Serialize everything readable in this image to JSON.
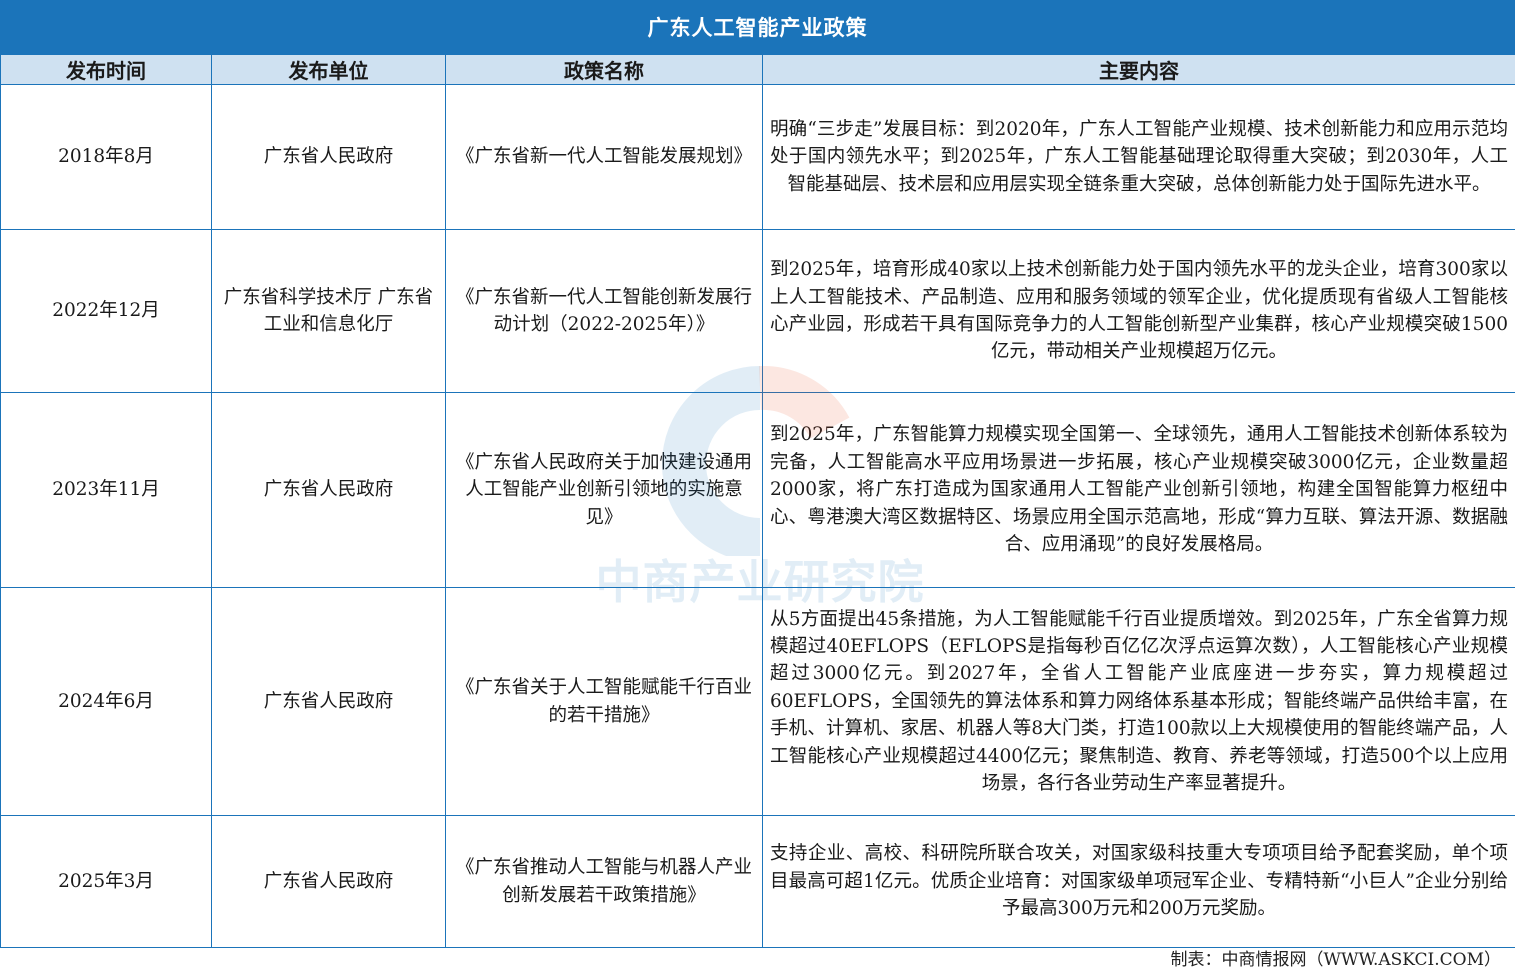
{
  "title": "广东人工智能产业政策",
  "table": {
    "headers": [
      "发布时间",
      "发布单位",
      "政策名称",
      "主要内容"
    ],
    "rows": [
      {
        "date": "2018年8月",
        "issuer": "广东省人民政府",
        "policy": "《广东省新一代人工智能发展规划》",
        "content": "明确“三步走”发展目标：到2020年，广东人工智能产业规模、技术创新能力和应用示范均处于国内领先水平；到2025年，广东人工智能基础理论取得重大突破；到2030年，人工智能基础层、技术层和应用层实现全链条重大突破，总体创新能力处于国际先进水平。"
      },
      {
        "date": "2022年12月",
        "issuer": "广东省科学技术厅 广东省工业和信息化厅",
        "policy": "《广东省新一代人工智能创新发展行动计划（2022-2025年）》",
        "content": "到2025年，培育形成40家以上技术创新能力处于国内领先水平的龙头企业，培育300家以上人工智能技术、产品制造、应用和服务领域的领军企业，优化提质现有省级人工智能核心产业园，形成若干具有国际竞争力的人工智能创新型产业集群，核心产业规模突破1500亿元，带动相关产业规模超万亿元。"
      },
      {
        "date": "2023年11月",
        "issuer": "广东省人民政府",
        "policy": "《广东省人民政府关于加快建设通用人工智能产业创新引领地的实施意见》",
        "content": "到2025年，广东智能算力规模实现全国第一、全球领先，通用人工智能技术创新体系较为完备，人工智能高水平应用场景进一步拓展，核心产业规模突破3000亿元，企业数量超2000家，将广东打造成为国家通用人工智能产业创新引领地，构建全国智能算力枢纽中心、粤港澳大湾区数据特区、场景应用全国示范高地，形成“算力互联、算法开源、数据融合、应用涌现”的良好发展格局。"
      },
      {
        "date": "2024年6月",
        "issuer": "广东省人民政府",
        "policy": "《广东省关于人工智能赋能千行百业的若干措施》",
        "content": "从5方面提出45条措施，为人工智能赋能千行百业提质增效。到2025年，广东全省算力规模超过40EFLOPS（EFLOPS是指每秒百亿亿次浮点运算次数），人工智能核心产业规模超过3000亿元。到2027年，全省人工智能产业底座进一步夯实，算力规模超过60EFLOPS，全国领先的算法体系和算力网络体系基本形成；智能终端产品供给丰富，在手机、计算机、家居、机器人等8大门类，打造100款以上大规模使用的智能终端产品，人工智能核心产业规模超过4400亿元；聚焦制造、教育、养老等领域，打造500个以上应用场景，各行各业劳动生产率显著提升。"
      },
      {
        "date": "2025年3月",
        "issuer": "广东省人民政府",
        "policy": "《广东省推动人工智能与机器人产业创新发展若干政策措施》",
        "content": "支持企业、高校、科研院所联合攻关，对国家级科技重大专项项目给予配套奖励，单个项目最高可超1亿元。优质企业培育：对国家级单项冠军企业、专精特新“小巨人”企业分别给予最高300万元和200万元奖励。"
      }
    ]
  },
  "footer": "制表：中商情报网（WWW.ASKCI.COM）",
  "watermark": "中商产业研究院",
  "colors": {
    "header_blue": "#1b74ba",
    "header_cell_bg": "#cfe1f1"
  }
}
